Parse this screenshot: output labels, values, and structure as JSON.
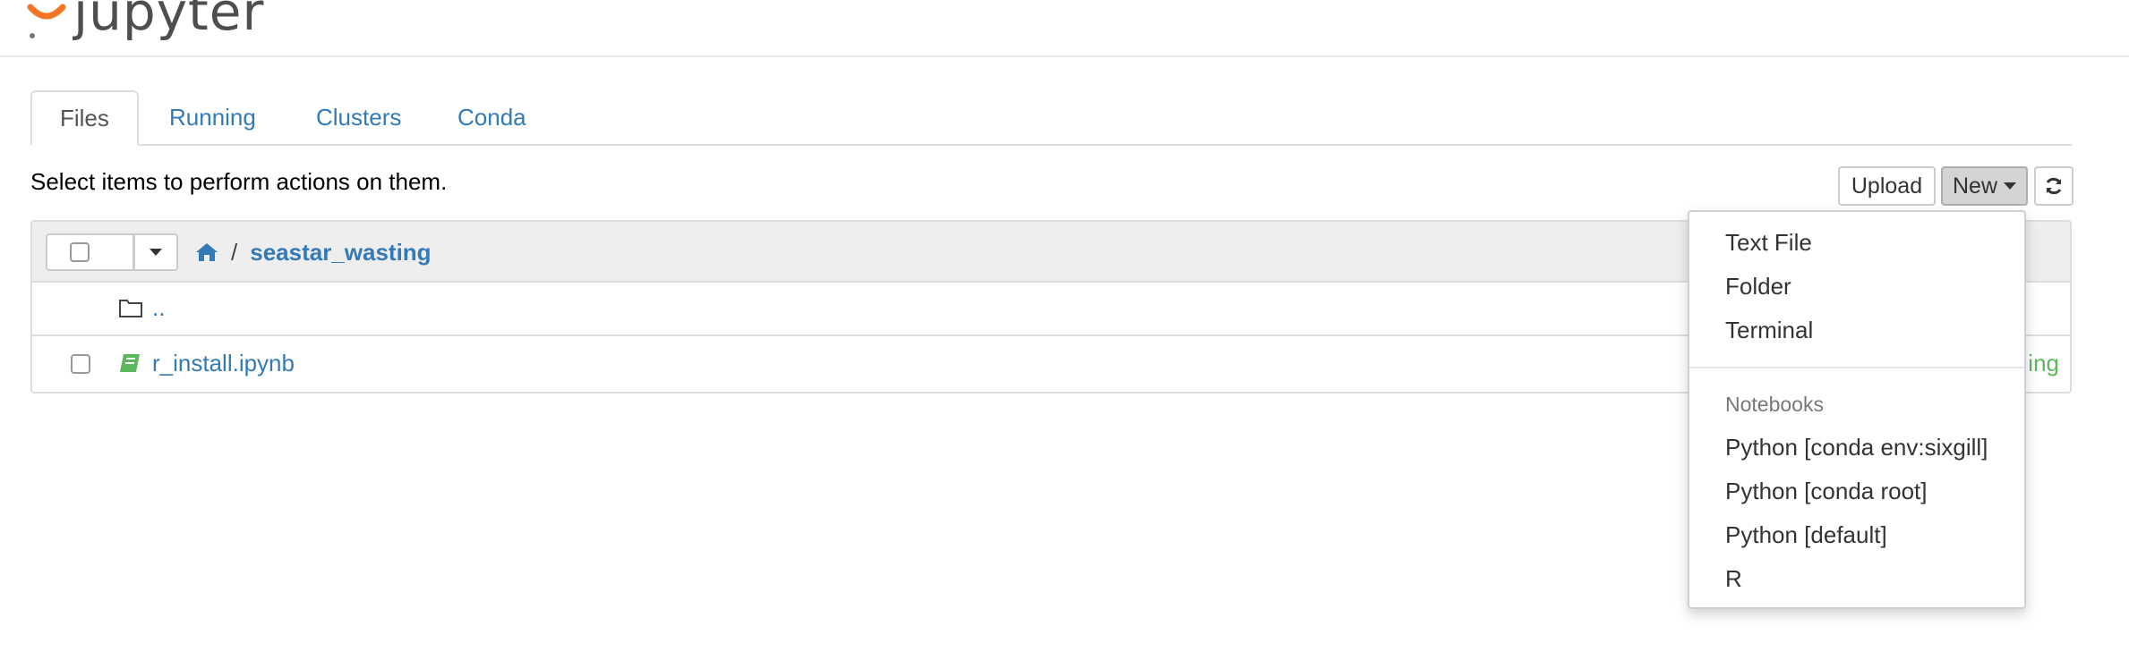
{
  "app": {
    "logo_text": "jupyter"
  },
  "tabs": [
    {
      "label": "Files"
    },
    {
      "label": "Running"
    },
    {
      "label": "Clusters"
    },
    {
      "label": "Conda"
    }
  ],
  "toolbar": {
    "instructions": "Select items to perform actions on them.",
    "upload_label": "Upload",
    "new_label": "New"
  },
  "breadcrumb": {
    "separator": "/",
    "folder": "seastar_wasting"
  },
  "files": [
    {
      "name": "..",
      "type": "folder",
      "status": ""
    },
    {
      "name": "r_install.ipynb",
      "type": "notebook",
      "status": "ing"
    }
  ],
  "new_menu": {
    "items": [
      "Text File",
      "Folder",
      "Terminal"
    ],
    "section_header": "Notebooks",
    "notebooks": [
      "Python [conda env:sixgill]",
      "Python [conda root]",
      "Python [default]",
      "R"
    ]
  },
  "colors": {
    "link": "#337ab7",
    "running": "#5cb85c",
    "logo_orange": "#f37626"
  },
  "icons": [
    "jupyter-logo-icon",
    "home-icon",
    "folder-icon",
    "notebook-icon",
    "refresh-icon",
    "caret-down-icon"
  ]
}
